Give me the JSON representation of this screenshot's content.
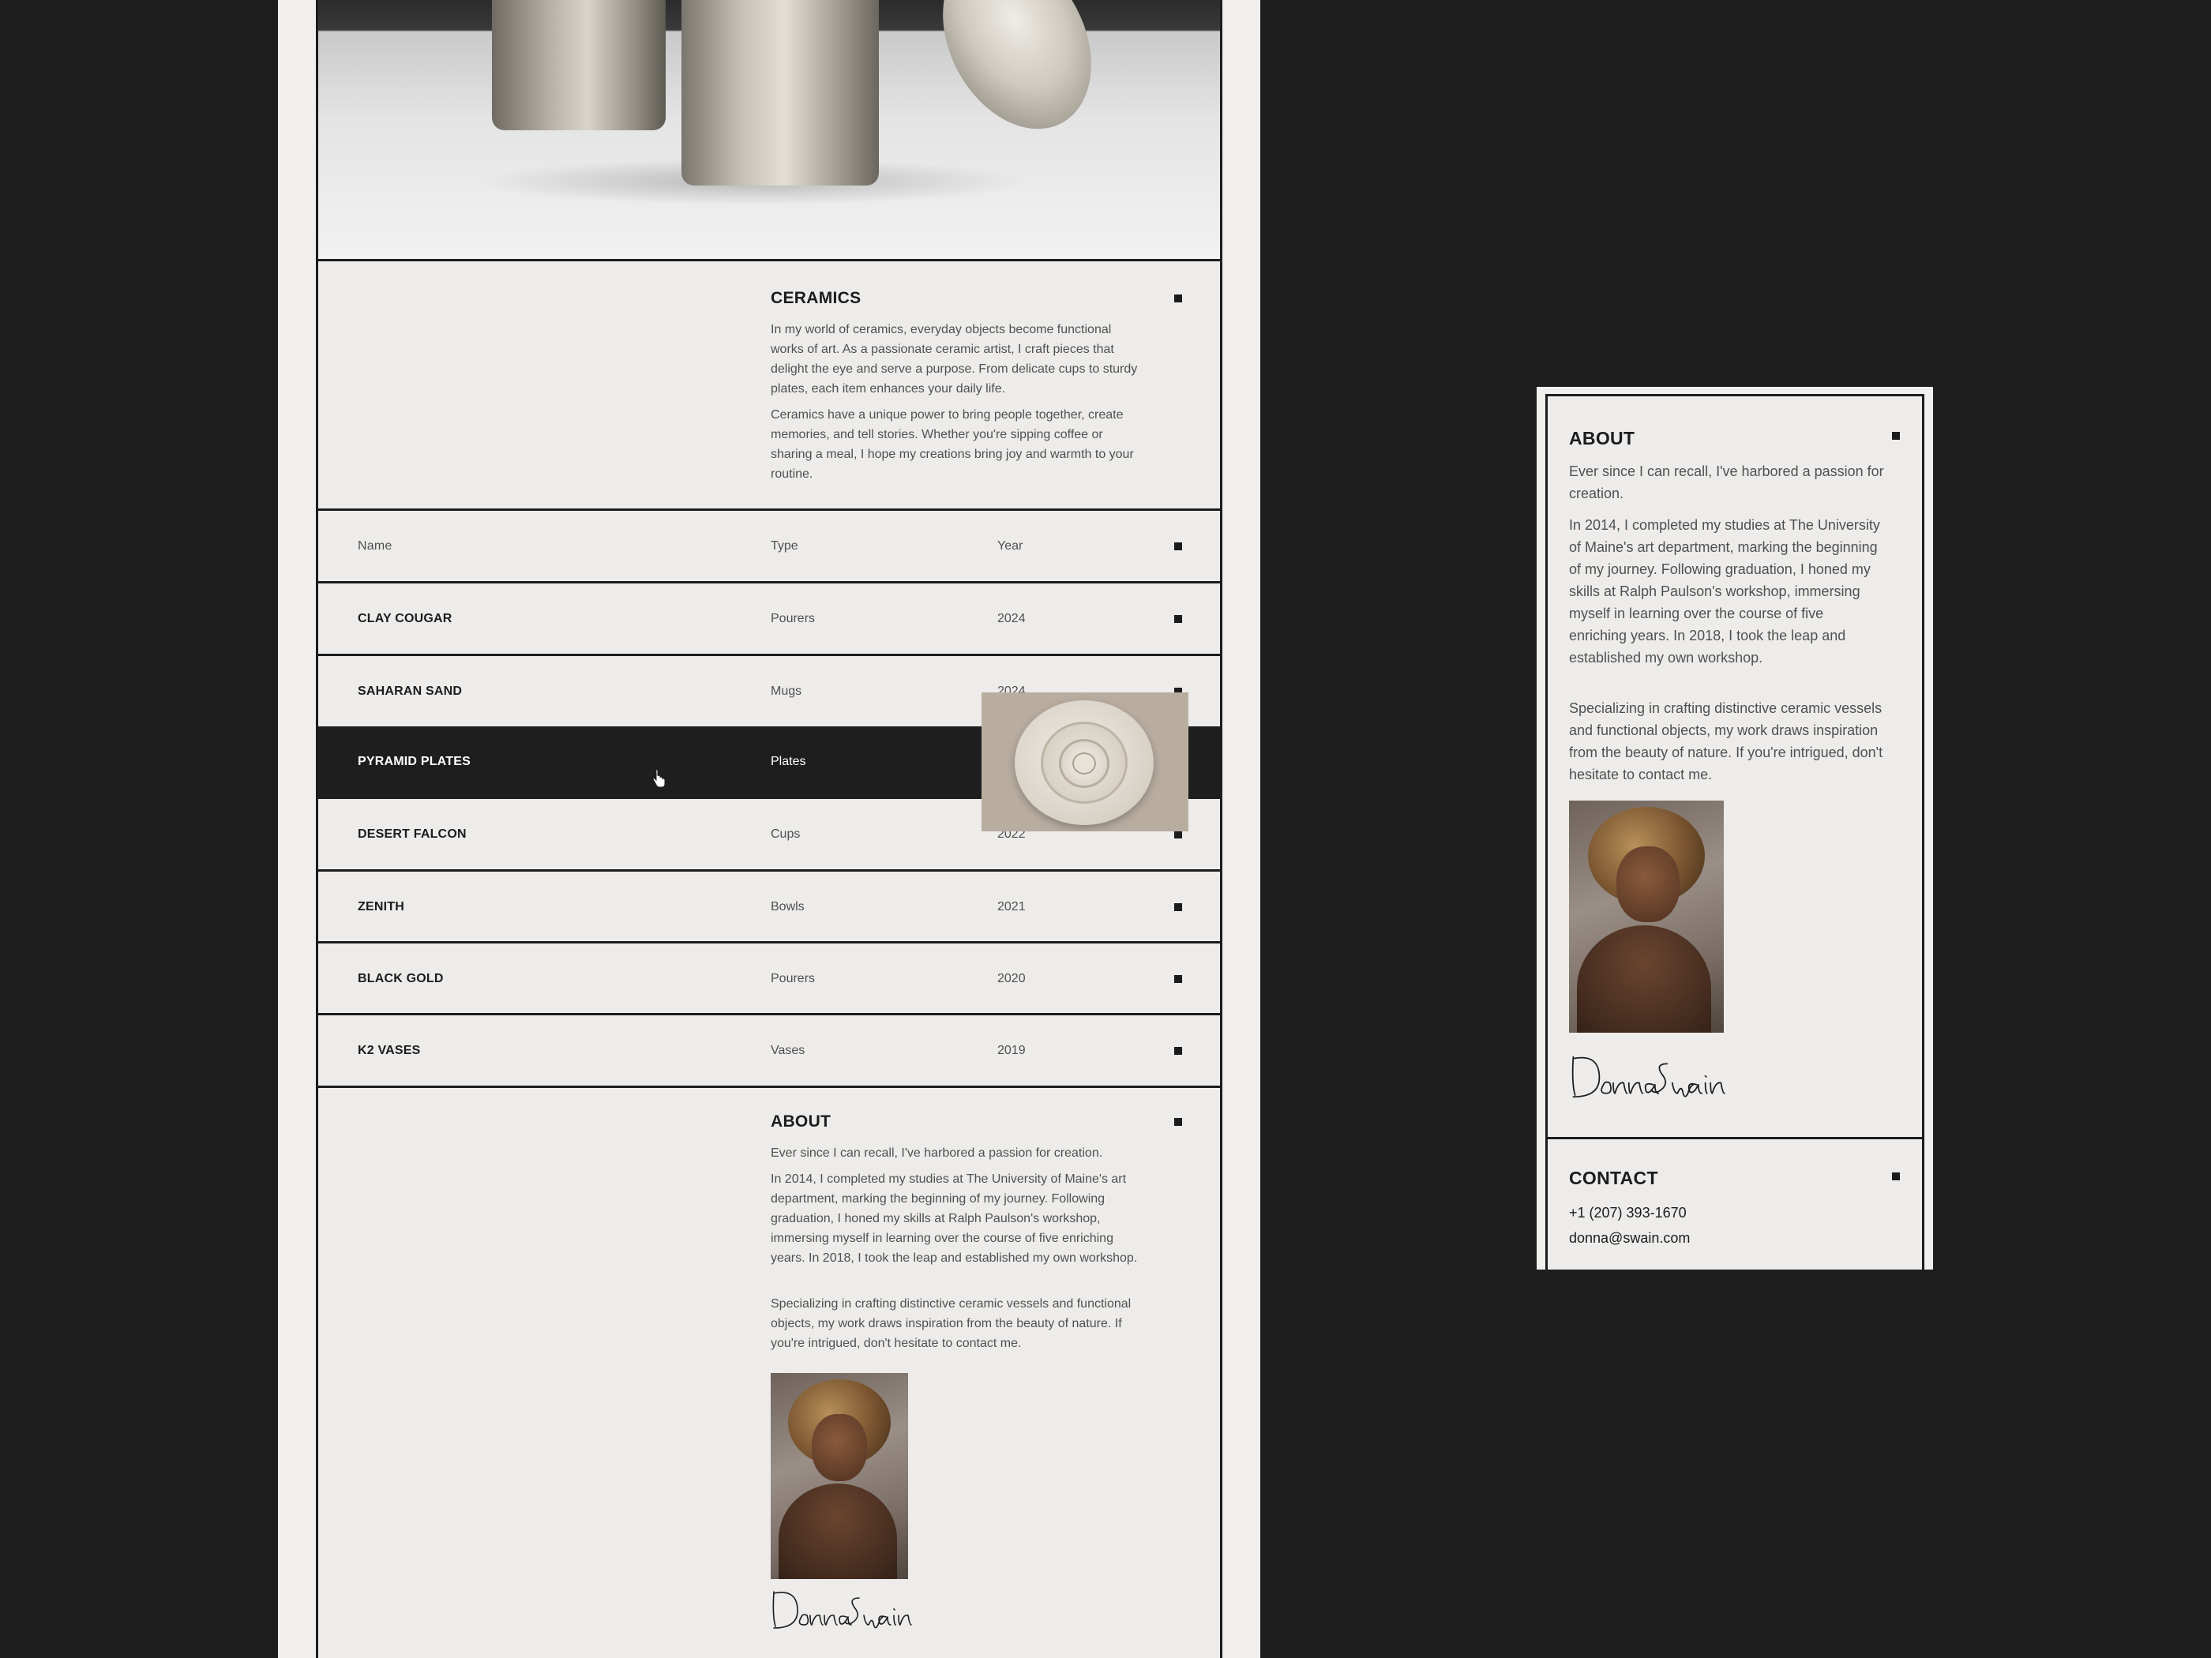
{
  "ceramics": {
    "title": "CERAMICS",
    "paragraphs": [
      "In my world of ceramics, everyday objects become functional works of art. As a passionate ceramic artist, I craft pieces that delight the eye and serve a purpose. From delicate cups to sturdy plates, each item enhances your daily life.",
      "Ceramics have a unique power to bring people together, create memories, and tell stories. Whether you're sipping coffee or sharing a meal, I hope my creations bring joy and warmth to your routine."
    ]
  },
  "table": {
    "headers": {
      "name": "Name",
      "type": "Type",
      "year": "Year"
    },
    "rows": [
      {
        "name": "CLAY COUGAR",
        "type": "Pourers",
        "year": "2024"
      },
      {
        "name": "SAHARAN SAND",
        "type": "Mugs",
        "year": "2024"
      },
      {
        "name": "PYRAMID PLATES",
        "type": "Plates",
        "year": ""
      },
      {
        "name": "DESERT FALCON",
        "type": "Cups",
        "year": "2022"
      },
      {
        "name": "ZENITH",
        "type": "Bowls",
        "year": "2021"
      },
      {
        "name": "BLACK GOLD",
        "type": "Pourers",
        "year": "2020"
      },
      {
        "name": "K2 VASES",
        "type": "Vases",
        "year": "2019"
      }
    ],
    "active_row": "PYRAMID PLATES"
  },
  "about": {
    "title": "ABOUT",
    "paragraphs": [
      "Ever since I can recall, I've harbored a passion for creation.",
      "In 2014, I completed my studies at The University of Maine's art department, marking the beginning of my journey. Following graduation, I honed my skills at Ralph Paulson's workshop, immersing myself in learning over the course of five enriching years. In 2018, I took the leap and established my own workshop.",
      "Specializing in crafting distinctive ceramic vessels and functional objects, my work draws inspiration from the beauty of nature. If you're intrigued, don't hesitate to contact me."
    ],
    "signature": "Donna Swain"
  },
  "contact": {
    "title": "CONTACT",
    "phone": "+1 (207) 393-1670",
    "email": "donna@swain.com"
  },
  "icons": {
    "section_marker": "square-bullet-icon",
    "cursor": "hand-pointer-icon"
  },
  "colors": {
    "page_bg": "#1e1e1e",
    "frame_bg": "#edecea",
    "ink": "#1c1c1c",
    "muted": "#505050",
    "active_row_bg": "#1e1e1e"
  }
}
